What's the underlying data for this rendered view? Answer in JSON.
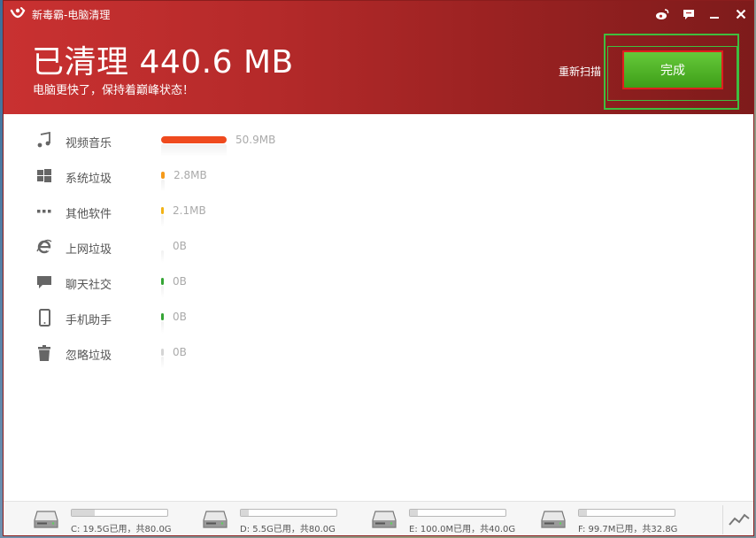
{
  "window": {
    "title": "新毒霸-电脑清理"
  },
  "header": {
    "headline": "已清理 440.6 MB",
    "subline": "电脑更快了，保持着巅峰状态！",
    "rescan_label": "重新扫描",
    "done_label": "完成"
  },
  "categories": [
    {
      "label": "视频音乐",
      "value": "50.9MB",
      "fraction": 1.0,
      "color": "#ef4a1e",
      "icon": "music-icon"
    },
    {
      "label": "系统垃圾",
      "value": "2.8MB",
      "fraction": 0.055,
      "color": "#f59a1a",
      "icon": "windows-icon"
    },
    {
      "label": "其他软件",
      "value": "2.1MB",
      "fraction": 0.041,
      "color": "#f2b316",
      "icon": "more-dots-icon"
    },
    {
      "label": "上网垃圾",
      "value": "0B",
      "fraction": 0,
      "color": "#cccccc",
      "icon": "ie-icon"
    },
    {
      "label": "聊天社交",
      "value": "0B",
      "fraction": 0,
      "color": "#35a535",
      "icon": "chat-bubble-icon"
    },
    {
      "label": "手机助手",
      "value": "0B",
      "fraction": 0,
      "color": "#35a535",
      "icon": "phone-icon"
    },
    {
      "label": "忽略垃圾",
      "value": "0B",
      "fraction": 0,
      "color": "#d5d5d5",
      "icon": "trash-icon"
    }
  ],
  "drives": [
    {
      "text": "C: 19.5G已用，共80.0G",
      "used_fraction": 0.244
    },
    {
      "text": "D: 5.5G已用，共80.0G",
      "used_fraction": 0.069
    },
    {
      "text": "E: 100.0M已用，共40.0G",
      "used_fraction": 0.003
    },
    {
      "text": "F: 99.7M已用，共32.8G",
      "used_fraction": 0.003
    }
  ],
  "colors": {
    "header_red": "#b52a2a",
    "done_green": "#4caf22",
    "highlight_green": "#3fbe3f",
    "highlight_red": "#e01e1e"
  }
}
